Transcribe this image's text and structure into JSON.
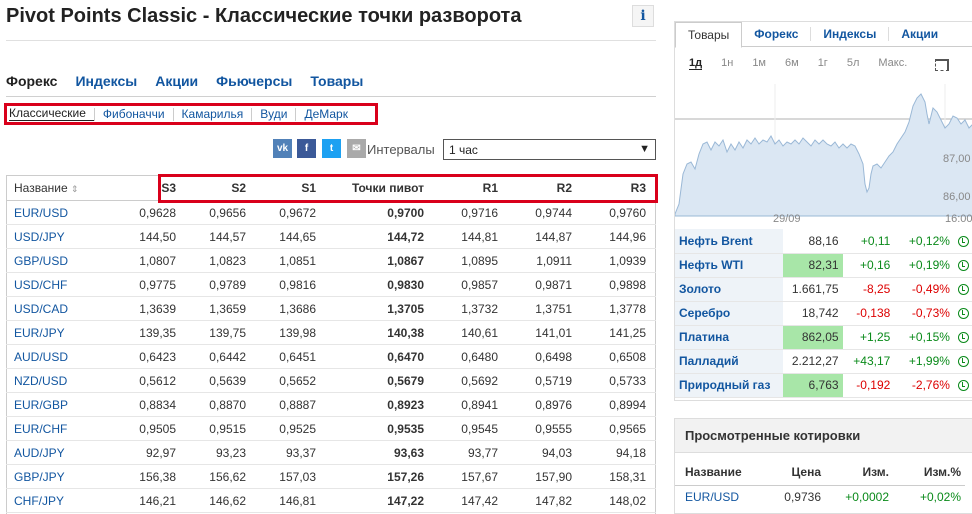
{
  "title": "Pivot Points Classic - Классические точки разворота",
  "info_icon": "i",
  "tabs": [
    "Форекс",
    "Индексы",
    "Акции",
    "Фьючерсы",
    "Товары"
  ],
  "subtabs": [
    "Классические",
    "Фибоначчи",
    "Камарилья",
    "Вуди",
    "ДеМарк"
  ],
  "share_icons": [
    "vk-icon",
    "facebook-icon",
    "twitter-icon",
    "email-icon"
  ],
  "interval_label": "Интервалы",
  "interval_value": "1 час",
  "table": {
    "headers": [
      "Название",
      "S3",
      "S2",
      "S1",
      "Точки пивот",
      "R1",
      "R2",
      "R3"
    ],
    "sort_glyph": "⇕",
    "rows": [
      [
        "EUR/USD",
        "0,9628",
        "0,9656",
        "0,9672",
        "0,9700",
        "0,9716",
        "0,9744",
        "0,9760"
      ],
      [
        "USD/JPY",
        "144,50",
        "144,57",
        "144,65",
        "144,72",
        "144,81",
        "144,87",
        "144,96"
      ],
      [
        "GBP/USD",
        "1,0807",
        "1,0823",
        "1,0851",
        "1,0867",
        "1,0895",
        "1,0911",
        "1,0939"
      ],
      [
        "USD/CHF",
        "0,9775",
        "0,9789",
        "0,9816",
        "0,9830",
        "0,9857",
        "0,9871",
        "0,9898"
      ],
      [
        "USD/CAD",
        "1,3639",
        "1,3659",
        "1,3686",
        "1,3705",
        "1,3732",
        "1,3751",
        "1,3778"
      ],
      [
        "EUR/JPY",
        "139,35",
        "139,75",
        "139,98",
        "140,38",
        "140,61",
        "141,01",
        "141,25"
      ],
      [
        "AUD/USD",
        "0,6423",
        "0,6442",
        "0,6451",
        "0,6470",
        "0,6480",
        "0,6498",
        "0,6508"
      ],
      [
        "NZD/USD",
        "0,5612",
        "0,5639",
        "0,5652",
        "0,5679",
        "0,5692",
        "0,5719",
        "0,5733"
      ],
      [
        "EUR/GBP",
        "0,8834",
        "0,8870",
        "0,8887",
        "0,8923",
        "0,8941",
        "0,8976",
        "0,8994"
      ],
      [
        "EUR/CHF",
        "0,9505",
        "0,9515",
        "0,9525",
        "0,9535",
        "0,9545",
        "0,9555",
        "0,9565"
      ],
      [
        "AUD/JPY",
        "92,97",
        "93,23",
        "93,37",
        "93,63",
        "93,77",
        "94,03",
        "94,18"
      ],
      [
        "GBP/JPY",
        "156,38",
        "156,62",
        "157,03",
        "157,26",
        "157,67",
        "157,90",
        "158,31"
      ],
      [
        "CHF/JPY",
        "146,21",
        "146,62",
        "146,81",
        "147,22",
        "147,42",
        "147,82",
        "148,02"
      ]
    ]
  },
  "sidebar": {
    "tabs": [
      "Товары",
      "Форекс",
      "Индексы",
      "Акции"
    ],
    "periods": [
      "1д",
      "1н",
      "1м",
      "6м",
      "1г",
      "5л",
      "Макс."
    ],
    "chart_labels": {
      "y1": "87,00",
      "y2": "86,00",
      "x1": "29/09",
      "x2": "16:00"
    },
    "quotes": [
      {
        "name": "Нефть Brent",
        "price": "88,16",
        "chg": "+0,11",
        "pct": "+0,12%",
        "dir": "up",
        "hl": false
      },
      {
        "name": "Нефть WTI",
        "price": "82,31",
        "chg": "+0,16",
        "pct": "+0,19%",
        "dir": "up",
        "hl": true
      },
      {
        "name": "Золото",
        "price": "1.661,75",
        "chg": "-8,25",
        "pct": "-0,49%",
        "dir": "down",
        "hl": false
      },
      {
        "name": "Серебро",
        "price": "18,742",
        "chg": "-0,138",
        "pct": "-0,73%",
        "dir": "down",
        "hl": false
      },
      {
        "name": "Платина",
        "price": "862,05",
        "chg": "+1,25",
        "pct": "+0,15%",
        "dir": "up",
        "hl": true
      },
      {
        "name": "Палладий",
        "price": "2.212,27",
        "chg": "+43,17",
        "pct": "+1,99%",
        "dir": "up",
        "hl": false
      },
      {
        "name": "Природный газ",
        "price": "6,763",
        "chg": "-0,192",
        "pct": "-2,76%",
        "dir": "down",
        "hl": true
      }
    ]
  },
  "viewed": {
    "title": "Просмотренные котировки",
    "headers": [
      "Название",
      "Цена",
      "Изм.",
      "Изм.%"
    ],
    "rows": [
      [
        "EUR/USD",
        "0,9736",
        "+0,0002",
        "+0,02%"
      ]
    ]
  }
}
